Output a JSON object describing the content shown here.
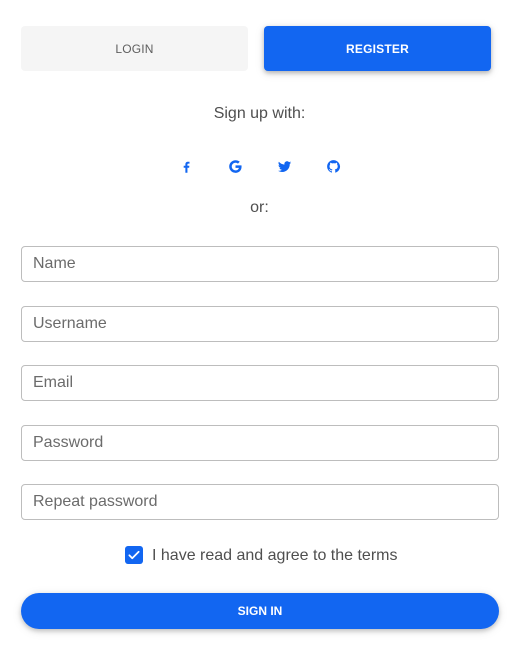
{
  "tabs": {
    "login_label": "LOGIN",
    "register_label": "REGISTER",
    "active": "register"
  },
  "signup": {
    "text": "Sign up with:",
    "providers": [
      {
        "icon": "facebook-icon"
      },
      {
        "icon": "google-icon"
      },
      {
        "icon": "twitter-icon"
      },
      {
        "icon": "github-icon"
      }
    ]
  },
  "divider_text": "or:",
  "form": {
    "name_placeholder": "Name",
    "username_placeholder": "Username",
    "email_placeholder": "Email",
    "password_placeholder": "Password",
    "repeat_password_placeholder": "Repeat password",
    "terms_label": "I have read and agree to the terms",
    "terms_checked": true,
    "submit_label": "SIGN IN"
  },
  "colors": {
    "accent": "#1266f1",
    "tab_inactive_bg": "#f5f5f5",
    "text": "#4f4f4f",
    "border": "#bdbdbd"
  }
}
